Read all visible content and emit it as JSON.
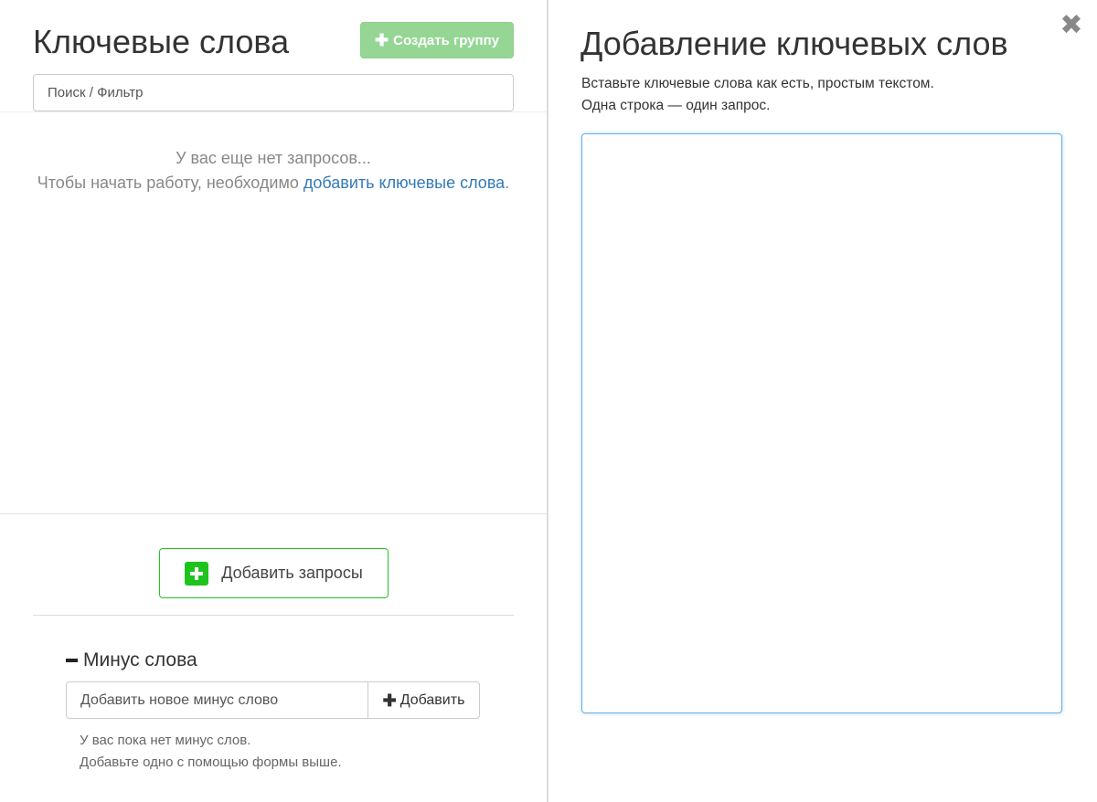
{
  "left": {
    "title": "Ключевые слова",
    "create_group_label": "Создать группу",
    "search_placeholder": "Поиск / Фильтр",
    "empty": {
      "line1": "У вас еще нет запросов...",
      "line2_prefix": "Чтобы начать работу, необходимо ",
      "link_text": "добавить ключевые слова",
      "line2_suffix": "."
    },
    "add_queries_label": "Добавить запросы",
    "minus": {
      "heading": "Минус слова",
      "input_placeholder": "Добавить новое минус слово",
      "add_label": "Добавить",
      "empty_line1": "У вас пока нет минус слов.",
      "empty_line2": "Добавьте одно с помощью формы выше."
    }
  },
  "right": {
    "title": "Добавление ключевых слов",
    "close_glyph": "✖",
    "instruction_line1": "Вставьте ключевые слова как есть, простым текстом.",
    "instruction_line2": "Одна строка — один запрос.",
    "textarea_value": ""
  },
  "colors": {
    "create_group_bg": "#95d695",
    "add_queries_border": "#22c422",
    "green_icon": "#1ec31e",
    "link": "#337ab7",
    "textarea_focus": "#66afe9"
  }
}
